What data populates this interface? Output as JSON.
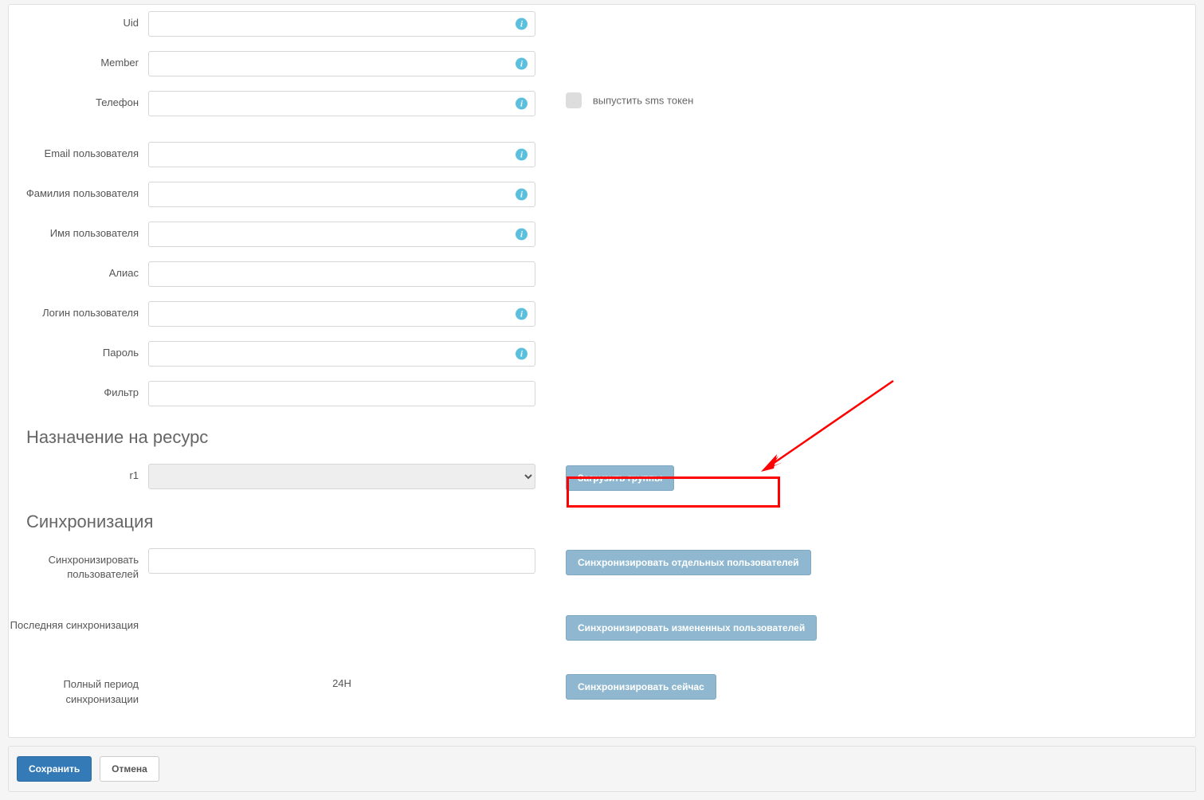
{
  "fields": {
    "uid": {
      "label": "Uid",
      "has_info": true
    },
    "member": {
      "label": "Member",
      "has_info": true
    },
    "phone": {
      "label": "Телефон",
      "has_info": true
    },
    "email": {
      "label": "Email пользователя",
      "has_info": true
    },
    "lastname": {
      "label": "Фамилия пользователя",
      "has_info": true
    },
    "firstname": {
      "label": "Имя пользователя",
      "has_info": true
    },
    "alias": {
      "label": "Алиас",
      "has_info": false
    },
    "login": {
      "label": "Логин пользователя",
      "has_info": true
    },
    "password": {
      "label": "Пароль",
      "has_info": true
    },
    "filter": {
      "label": "Фильтр",
      "has_info": false
    }
  },
  "sms_checkbox_label": "выпустить sms токен",
  "sections": {
    "resource_assignment": "Назначение на ресурс",
    "synchronization": "Синхронизация"
  },
  "resource": {
    "r1_label": "r1",
    "load_groups_btn": "Загрузить группы"
  },
  "sync": {
    "sync_users_label": "Синхронизировать пользователей",
    "sync_individual_btn": "Синхронизировать отдельных пользователей",
    "last_sync_label": "Последняя синхронизация",
    "sync_changed_btn": "Синхронизировать измененных пользователей",
    "full_period_label": "Полный период синхронизации",
    "full_period_value": "24H",
    "sync_now_btn": "Синхронизировать сейчас"
  },
  "footer": {
    "save": "Сохранить",
    "cancel": "Отмена"
  }
}
